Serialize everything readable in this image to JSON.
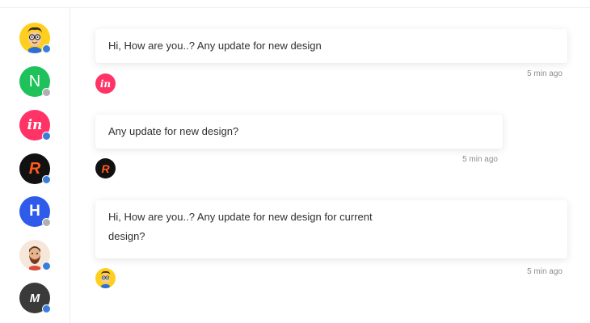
{
  "contacts": [
    {
      "name": "avatar-cartoon-glasses",
      "status_color": "#3b7ddd"
    },
    {
      "name": "avatar-n-logo",
      "status_color": "#b0b0b0"
    },
    {
      "name": "avatar-invision-logo",
      "status_color": "#3b7ddd"
    },
    {
      "name": "avatar-r-logo",
      "status_color": "#3b7ddd"
    },
    {
      "name": "avatar-h-logo",
      "status_color": "#b0b0b0"
    },
    {
      "name": "avatar-bearded-man",
      "status_color": "#3b7ddd"
    },
    {
      "name": "avatar-m-logo",
      "status_color": "#3b7ddd"
    }
  ],
  "messages": [
    {
      "text": "Hi, How are you..? Any update for new design",
      "time": "5 min ago",
      "sender_icon": "invision-logo-icon"
    },
    {
      "text": "Any update for new design?",
      "time": "5 min ago",
      "sender_icon": "r-logo-icon"
    },
    {
      "text_line1": "Hi, How are you..? Any update for new design for current",
      "text_line2": "design?",
      "time": "5 min ago",
      "sender_icon": "cartoon-glasses-icon"
    }
  ],
  "icon_letters": {
    "n": "N",
    "invision": "in",
    "r": "R",
    "h": "H",
    "m": "M"
  },
  "colors": {
    "n_green": "#1fc25a",
    "invision_pink": "#ff3366",
    "r_black": "#111111",
    "r_orange": "#ff5a1f",
    "h_blue": "#2f5bea",
    "m_dark": "#3a3a3a",
    "cartoon_yellow": "#ffcf1f",
    "beard_bg": "#f6e7da"
  }
}
